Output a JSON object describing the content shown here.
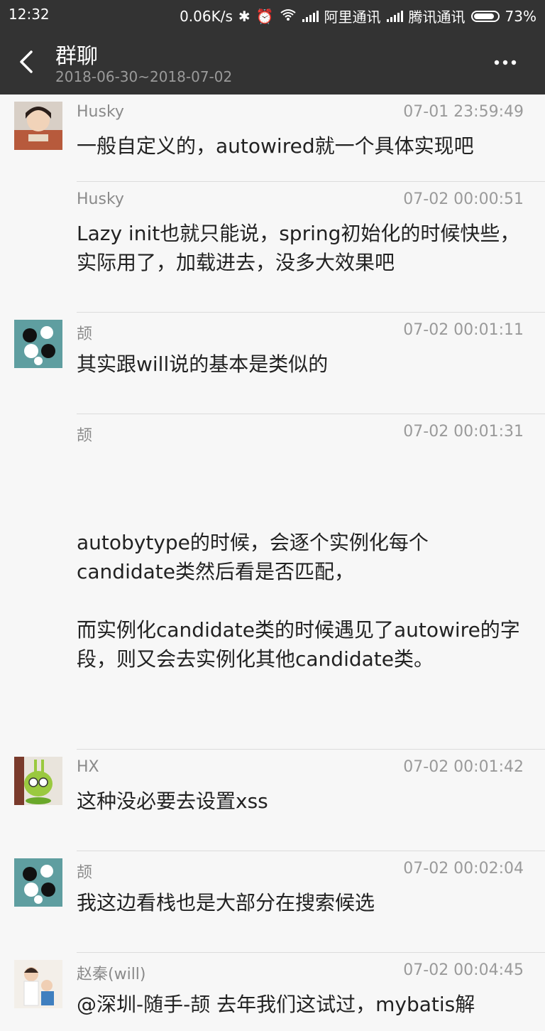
{
  "status_bar": {
    "time": "12:32",
    "net_speed": "0.06K/s",
    "carrier1": "阿里通讯",
    "carrier2": "腾讯通讯",
    "battery": "73%"
  },
  "header": {
    "title": "群聊",
    "date_range": "2018-06-30~2018-07-02"
  },
  "messages": [
    {
      "name": "Husky",
      "time": "07-01 23:59:49",
      "text": "一般自定义的，autowired就一个具体实现吧",
      "avatar": "child-photo"
    },
    {
      "name": "Husky",
      "time": "07-02 00:00:51",
      "text": "Lazy init也就只能说，spring初始化的时候快些，实际用了，加载进去，没多大效果吧",
      "avatar": ""
    },
    {
      "name": "颉",
      "time": "07-02 00:01:11",
      "text": "其实跟will说的基本是类似的",
      "avatar": "cartoon-panda"
    },
    {
      "name": "颉",
      "time": "07-02 00:01:31",
      "text": "autobytype的时候，会逐个实例化每个candidate类然后看是否匹配，\n\n而实例化candidate类的时候遇见了autowire的字段，则又会去实例化其他candidate类。",
      "avatar": ""
    },
    {
      "name": "HX",
      "time": "07-02 00:01:42",
      "text": "这种没必要去设置xss",
      "avatar": "green-rabbit-toy"
    },
    {
      "name": "颉",
      "time": "07-02 00:02:04",
      "text": "我这边看栈也是大部分在搜索候选",
      "avatar": "cartoon-panda"
    },
    {
      "name": "赵秦(will)",
      "time": "07-02 00:04:45",
      "text": "@深圳-随手-颉 去年我们这试过，mybatis解",
      "avatar": "family-photo"
    }
  ]
}
